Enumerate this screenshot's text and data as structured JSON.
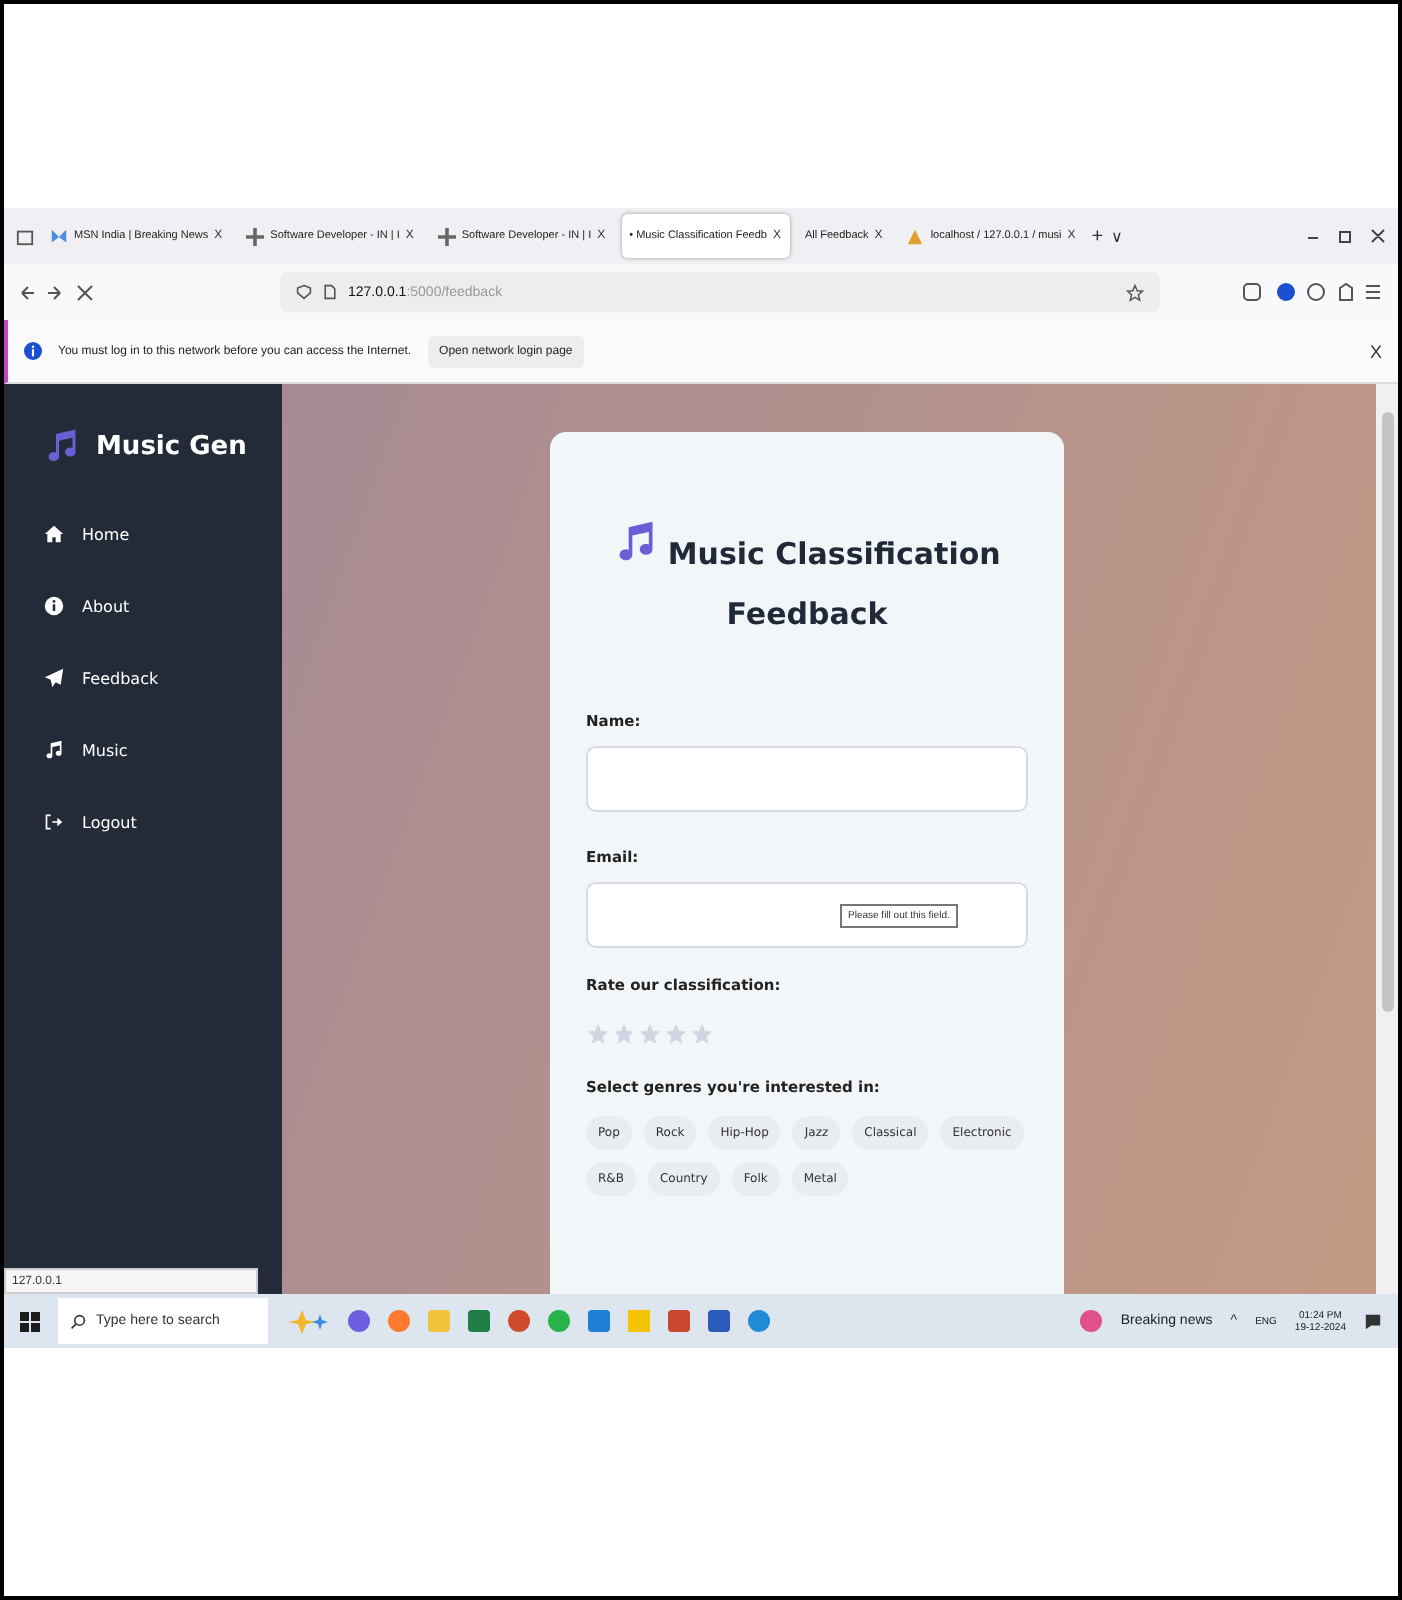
{
  "browser": {
    "tabs": [
      {
        "label": "MSN India | Breaking News",
        "close": "X",
        "selected": false,
        "kind": "msn"
      },
      {
        "label": "Software Developer - IN | I",
        "close": "X",
        "selected": false,
        "kind": "site"
      },
      {
        "label": "Software Developer - IN | I",
        "close": "X",
        "selected": false,
        "kind": "site"
      },
      {
        "label": "• Music Classification Feedb",
        "close": "X",
        "selected": true,
        "kind": "none"
      },
      {
        "label": "All Feedback",
        "close": "X",
        "selected": false,
        "kind": "none"
      },
      {
        "label": "localhost / 127.0.0.1 / musi",
        "close": "X",
        "selected": false,
        "kind": "db"
      }
    ],
    "new_tab": "+",
    "tab_list": "∨",
    "address": {
      "host": "127.0.0.1",
      "path": ":5000/feedback"
    },
    "notification": {
      "text": "You must log in to this network before you can access the Internet.",
      "button": "Open network login page",
      "close": "X"
    },
    "status_url": "127.0.0.1"
  },
  "sidebar": {
    "brand": "Music Gen",
    "items": [
      {
        "label": "Home",
        "kind": "home"
      },
      {
        "label": "About",
        "kind": "info"
      },
      {
        "label": "Feedback",
        "kind": "send"
      },
      {
        "label": "Music",
        "kind": "music"
      },
      {
        "label": "Logout",
        "kind": "logout"
      }
    ]
  },
  "form": {
    "title": "Music Classification Feedback",
    "fields": [
      {
        "label": "Name:"
      },
      {
        "label": "Email:",
        "tooltip": "Please fill out this field."
      }
    ],
    "rating": {
      "label": "Rate our classification:",
      "stars": 0
    },
    "genres": {
      "label": "Select genres you're interested in:",
      "items": [
        "Pop",
        "Rock",
        "Hip-Hop",
        "Jazz",
        "Classical",
        "Electronic",
        "R&B",
        "Country",
        "Folk",
        "Metal"
      ]
    }
  },
  "taskbar": {
    "tray_caret": "^",
    "search_placeholder": "Type here to search",
    "news": "Breaking news",
    "language": "ENG",
    "time": "01:24 PM",
    "date": "19-12-2024"
  }
}
